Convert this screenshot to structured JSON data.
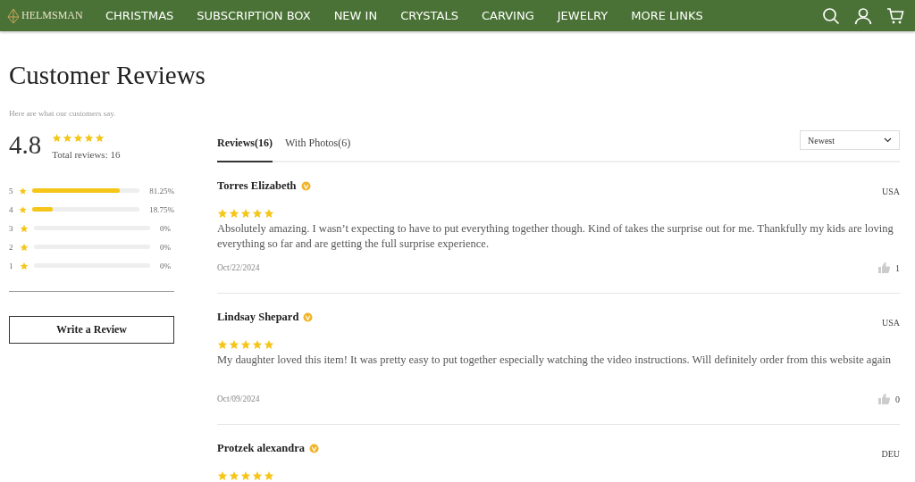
{
  "header": {
    "logo": "HELMSMAN",
    "nav": [
      "CHRISTMAS",
      "SUBSCRIPTION BOX",
      "NEW IN",
      "CRYSTALS",
      "CARVING",
      "JEWELRY",
      "MORE LINKS"
    ]
  },
  "page": {
    "title": "Customer Reviews",
    "subtitle": "Here are what our customers say."
  },
  "summary": {
    "score": "4.8",
    "stars": 5,
    "total": "Total reviews: 16",
    "bars": [
      {
        "label": "5",
        "level": 0.8125,
        "percent": "81.25%"
      },
      {
        "label": "4",
        "level": 0.1875,
        "percent": "18.75%"
      },
      {
        "label": "3",
        "level": 0,
        "percent": "0%"
      },
      {
        "label": "2",
        "level": 0,
        "percent": "0%"
      },
      {
        "label": "1",
        "level": 0,
        "percent": "0%"
      }
    ],
    "button": "Write a Review"
  },
  "tabs": [
    {
      "label": "Reviews(16)",
      "selected": true
    },
    {
      "label": "With Photos(6)",
      "selected": false
    }
  ],
  "sort": {
    "value": "Newest"
  },
  "reviews": [
    {
      "name": "Torres Elizabeth",
      "verified": true,
      "country": "USA",
      "stars": 5,
      "text": "Absolutely amazing. I wasn’t expecting to have to put everything together though. Kind of takes the surprise out for me. Thankfully my kids are loving everything so far and are getting the full surprise experience.",
      "date": "Oct/22/2024",
      "likes": "1"
    },
    {
      "name": "Lindsay Shepard",
      "verified": true,
      "country": "USA",
      "stars": 5,
      "text": "My daughter loved this item! It was pretty easy to put together especially watching the video instructions. Will definitely order from this website again",
      "date": "Oct/09/2024",
      "likes": "0"
    },
    {
      "name": "Protzek alexandra",
      "verified": true,
      "country": "DEU",
      "stars": 5
    }
  ]
}
